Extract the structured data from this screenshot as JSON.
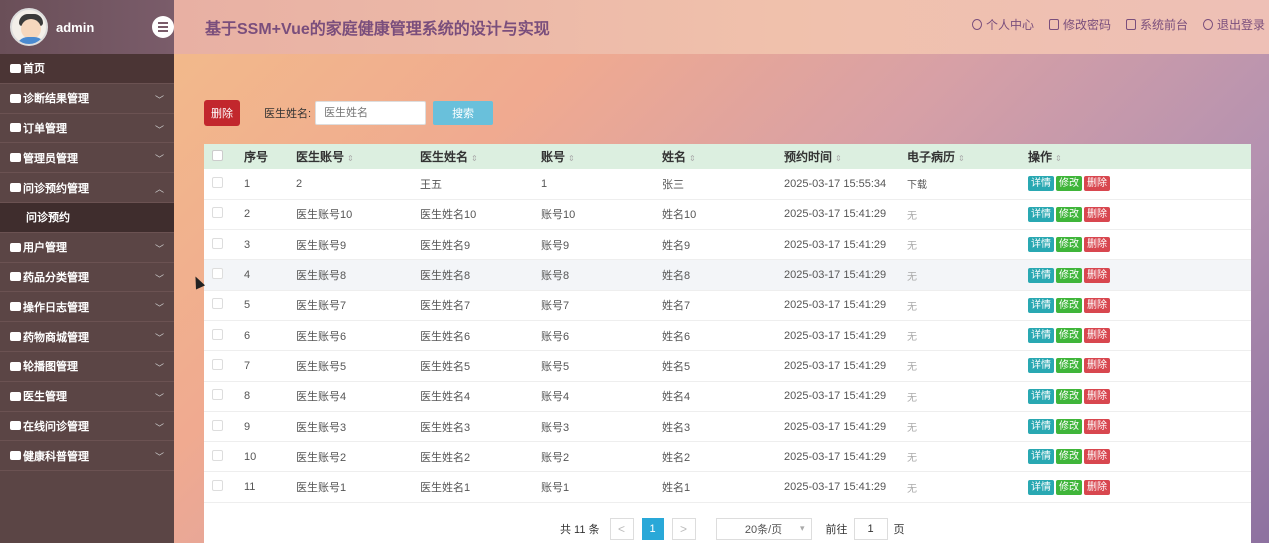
{
  "app": {
    "user": "admin",
    "title": "基于SSM+Vue的家庭健康管理系统的设计与实现"
  },
  "header": {
    "links": [
      "个人中心",
      "修改密码",
      "系统前台",
      "退出登录"
    ]
  },
  "sidebar": {
    "items": [
      {
        "label": "首页",
        "type": "home"
      },
      {
        "label": "诊断结果管理",
        "type": "group"
      },
      {
        "label": "订单管理",
        "type": "group"
      },
      {
        "label": "管理员管理",
        "type": "group"
      },
      {
        "label": "问诊预约管理",
        "type": "group-open"
      },
      {
        "label": "问诊预约",
        "type": "sub"
      },
      {
        "label": "用户管理",
        "type": "group"
      },
      {
        "label": "药品分类管理",
        "type": "group"
      },
      {
        "label": "操作日志管理",
        "type": "group"
      },
      {
        "label": "药物商城管理",
        "type": "group"
      },
      {
        "label": "轮播图管理",
        "type": "group"
      },
      {
        "label": "医生管理",
        "type": "group"
      },
      {
        "label": "在线问诊管理",
        "type": "group"
      },
      {
        "label": "健康科普管理",
        "type": "group"
      }
    ]
  },
  "toolbar": {
    "delete_label": "删除",
    "search_label": "医生姓名:",
    "search_placeholder": "医生姓名",
    "search_button": "搜索"
  },
  "table": {
    "columns": [
      "序号",
      "医生账号",
      "医生姓名",
      "账号",
      "姓名",
      "预约时间",
      "电子病历",
      "操作"
    ],
    "rows": [
      {
        "no": "1",
        "doc_acc": "2",
        "doc_name": "王五",
        "acc": "1",
        "name": "张三",
        "time": "2025-03-17 15:55:34",
        "record": "下载"
      },
      {
        "no": "2",
        "doc_acc": "医生账号10",
        "doc_name": "医生姓名10",
        "acc": "账号10",
        "name": "姓名10",
        "time": "2025-03-17 15:41:29",
        "record": "无"
      },
      {
        "no": "3",
        "doc_acc": "医生账号9",
        "doc_name": "医生姓名9",
        "acc": "账号9",
        "name": "姓名9",
        "time": "2025-03-17 15:41:29",
        "record": "无"
      },
      {
        "no": "4",
        "doc_acc": "医生账号8",
        "doc_name": "医生姓名8",
        "acc": "账号8",
        "name": "姓名8",
        "time": "2025-03-17 15:41:29",
        "record": "无"
      },
      {
        "no": "5",
        "doc_acc": "医生账号7",
        "doc_name": "医生姓名7",
        "acc": "账号7",
        "name": "姓名7",
        "time": "2025-03-17 15:41:29",
        "record": "无"
      },
      {
        "no": "6",
        "doc_acc": "医生账号6",
        "doc_name": "医生姓名6",
        "acc": "账号6",
        "name": "姓名6",
        "time": "2025-03-17 15:41:29",
        "record": "无"
      },
      {
        "no": "7",
        "doc_acc": "医生账号5",
        "doc_name": "医生姓名5",
        "acc": "账号5",
        "name": "姓名5",
        "time": "2025-03-17 15:41:29",
        "record": "无"
      },
      {
        "no": "8",
        "doc_acc": "医生账号4",
        "doc_name": "医生姓名4",
        "acc": "账号4",
        "name": "姓名4",
        "time": "2025-03-17 15:41:29",
        "record": "无"
      },
      {
        "no": "9",
        "doc_acc": "医生账号3",
        "doc_name": "医生姓名3",
        "acc": "账号3",
        "name": "姓名3",
        "time": "2025-03-17 15:41:29",
        "record": "无"
      },
      {
        "no": "10",
        "doc_acc": "医生账号2",
        "doc_name": "医生姓名2",
        "acc": "账号2",
        "name": "姓名2",
        "time": "2025-03-17 15:41:29",
        "record": "无"
      },
      {
        "no": "11",
        "doc_acc": "医生账号1",
        "doc_name": "医生姓名1",
        "acc": "账号1",
        "name": "姓名1",
        "time": "2025-03-17 15:41:29",
        "record": "无"
      }
    ],
    "actions": [
      "详情",
      "修改",
      "删除"
    ]
  },
  "pagination": {
    "total": "共 11 条",
    "prev": "<",
    "current": "1",
    "next": ">",
    "page_size": "20条/页",
    "goto_label": "前往",
    "goto_value": "1",
    "page_suffix": "页"
  },
  "colors": {
    "sidebar_bg": "#5b4545",
    "title": "#7a4e7c",
    "delete": "#c2272d",
    "search": "#69c0db",
    "detail": "#29a8b2",
    "edit": "#3fb53a",
    "remove": "#d8474f",
    "header_row": "#dcefe0"
  }
}
